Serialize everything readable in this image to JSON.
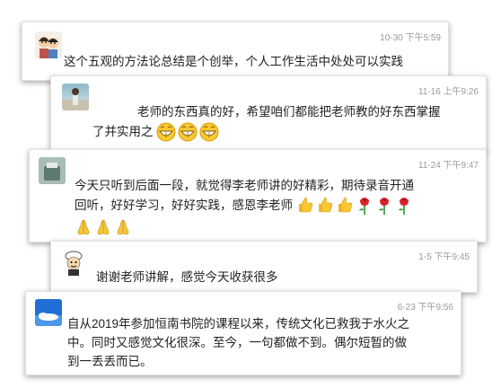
{
  "comments": [
    {
      "time": "10-30 下午5:59",
      "text": "这个五观的方法论总结是个创举，个人工作生活中处处可以实践"
    },
    {
      "time": "11-16 上午9:26",
      "text_line1": "老师的东西真的好，希望咱们都能把老师教的好东西掌握",
      "text_line2": "了并实用之",
      "emojis": [
        "grin-icon",
        "grin-icon",
        "grin-icon"
      ]
    },
    {
      "time": "11-24 下午9:47",
      "text_line1": "今天只听到后面一段，就觉得李老师讲的好精彩，期待录音开通",
      "text_line2": "回听，好好学习，好好实践，感恩李老师",
      "emojis": [
        "thumbs-up-icon",
        "thumbs-up-icon",
        "thumbs-up-icon",
        "rose-icon",
        "rose-icon",
        "rose-icon",
        "pray-icon",
        "pray-icon",
        "pray-icon"
      ]
    },
    {
      "time": "1-5 下午9:45",
      "text": "谢谢老师讲解，感觉今天收获很多"
    },
    {
      "time": "6-23 下午9:56",
      "text_line1": "自从2019年参加恒南书院的课程以来，传统文化已救我于水火之",
      "text_line2": "中。同时又感觉文化很深。至今，一句都做不到。偶尔短暂的做",
      "text_line3": "到一丢丢而已。"
    }
  ]
}
